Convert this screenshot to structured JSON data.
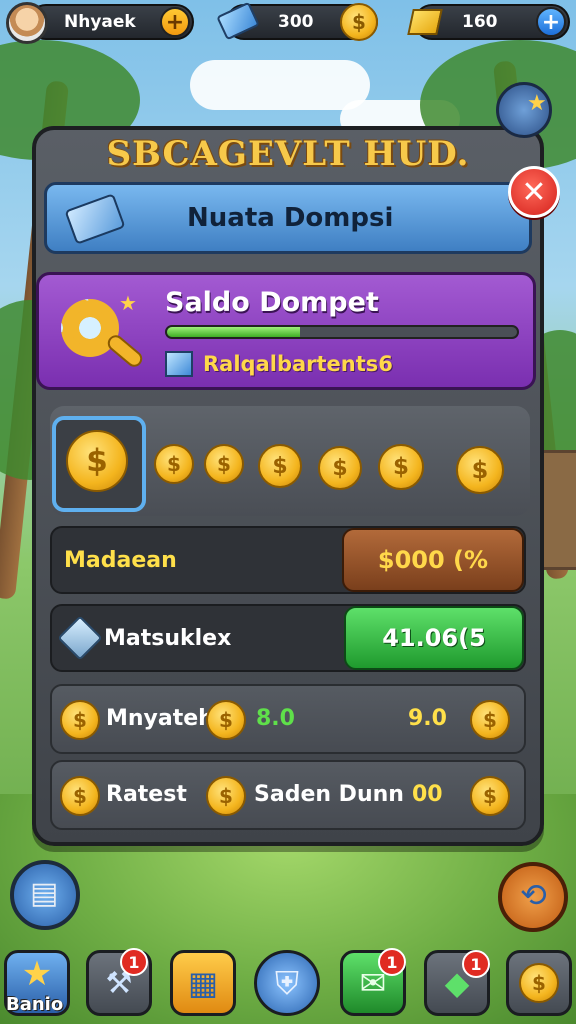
{
  "topbar": {
    "player_name": "Nhyaek",
    "gems_value": "300",
    "gold_value": "160"
  },
  "panel": {
    "title": "SBCAGEVLT HUD.",
    "header_label": "Nuata Dompsi",
    "wallet": {
      "title": "Saldo Dompet",
      "progress": 0.38,
      "sub_label": "Ralqalbartents6"
    },
    "coins": {
      "symbol": "$"
    },
    "rows": [
      {
        "label": "Madaean",
        "button": "$000 (%"
      },
      {
        "label": "Matsuklex",
        "button": "41.06(5"
      }
    ],
    "stat_rows": [
      {
        "left": "Mnyateh",
        "mid": "8.0",
        "right": "9.0"
      },
      {
        "left": "Ratest",
        "mid": "Saden Dunn",
        "right": "00"
      }
    ]
  },
  "nav": {
    "first_label": "Banio",
    "badges": [
      "1",
      "1",
      "1"
    ],
    "icons": [
      "star-icon",
      "hammer-icon",
      "chest-icon",
      "shield-icon",
      "mail-icon",
      "ticket-icon",
      "coin-icon"
    ]
  },
  "colors": {
    "accent_gold": "#f7c94a",
    "panel_purple": "#8a3fc0",
    "banner_blue": "#5a9ad8",
    "close_red": "#d3201b"
  }
}
